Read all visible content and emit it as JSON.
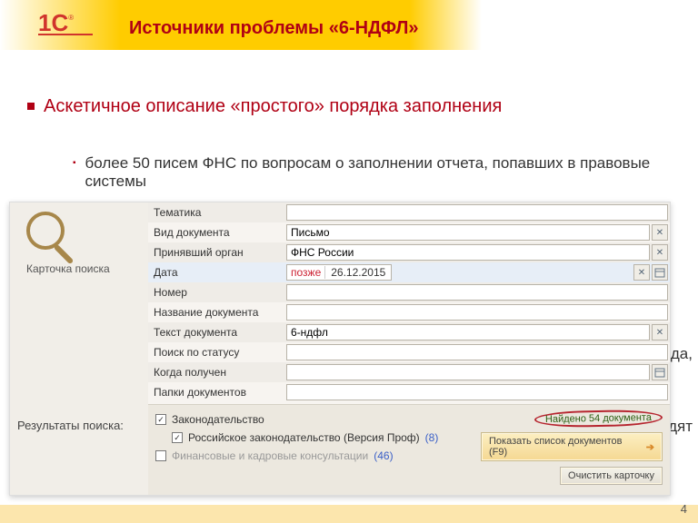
{
  "slide": {
    "title": "Источники проблемы «6-НДФЛ»",
    "bullet1": "Аскетичное описание «простого» порядка заполнения",
    "bullet2": "более 50 писем ФНС по вопросам о заполнении отчета, попавших в правовые системы",
    "fragment1": "да,",
    "fragment2": "одят",
    "page": "4"
  },
  "card": {
    "title": "Карточка поиска",
    "results_title": "Результаты поиска:"
  },
  "fields": [
    {
      "label": "Тематика",
      "value": "",
      "kind": "text"
    },
    {
      "label": "Вид документа",
      "value": "Письмо",
      "kind": "text"
    },
    {
      "label": "Принявший орган",
      "value": "ФНС России",
      "kind": "text"
    },
    {
      "label": "Дата",
      "kind": "date",
      "prefix": "позже",
      "value": "26.12.2015"
    },
    {
      "label": "Номер",
      "value": "",
      "kind": "text"
    },
    {
      "label": "Название документа",
      "value": "",
      "kind": "text"
    },
    {
      "label": "Текст документа",
      "value": "6-ндфл",
      "kind": "text"
    },
    {
      "label": "Поиск по статусу",
      "value": "",
      "kind": "text"
    },
    {
      "label": "Когда получен",
      "value": "",
      "kind": "text",
      "calendar": true
    },
    {
      "label": "Папки документов",
      "value": "",
      "kind": "text"
    }
  ],
  "results": {
    "found_label": "Найдено 54 документа",
    "show_button": "Показать список документов (F9)",
    "clear_button": "Очистить карточку"
  },
  "checks": [
    {
      "label": "Законодательство",
      "count": "",
      "checked": true,
      "indent": 0
    },
    {
      "label": "Российское законодательство (Версия Проф)",
      "count": "(8)",
      "checked": true,
      "indent": 1
    },
    {
      "label": "Финансовые и кадровые консультации",
      "count": "(46)",
      "checked": false,
      "indent": 0,
      "disabled": true
    }
  ],
  "icons": {
    "clear": "✕",
    "calendar": "📅"
  }
}
